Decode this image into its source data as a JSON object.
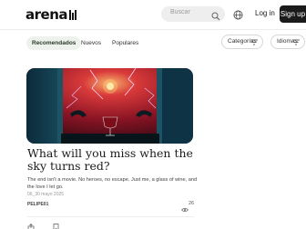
{
  "header": {
    "logo": "arena",
    "search_placeholder": "Buscar",
    "login_label": "Log in",
    "signup_label": "Sign up"
  },
  "tabs": [
    {
      "label": "Recomendados",
      "active": true
    },
    {
      "label": "Nuevos",
      "active": false
    },
    {
      "label": "Populares",
      "active": false
    }
  ],
  "filters": {
    "categories_label": "Categorías",
    "languages_label": "Idiomas"
  },
  "post": {
    "title": "What will you miss when the sky turns red?",
    "description": "The end isn't a movie. No heroes, no escape. Just me, a glass of wine, and the love I let go.",
    "date": "06_30 mayo 2025",
    "author": "PELIPE01",
    "views": "26"
  },
  "colors": {
    "accent_dark": "#1b1b1b",
    "tab_active_bg": "#edf3ec",
    "image_sky": "#8a1424"
  }
}
